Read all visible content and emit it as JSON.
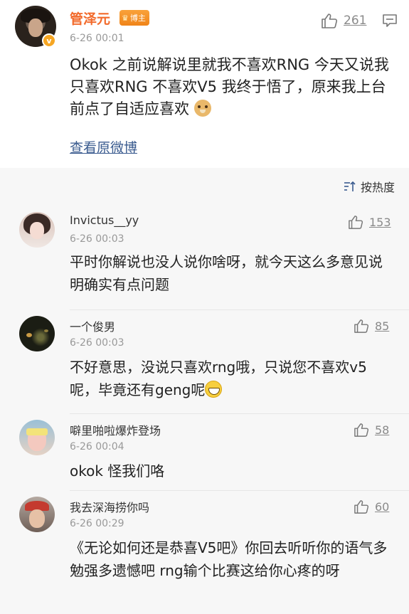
{
  "post": {
    "author": "管泽元",
    "badge_label": "博主",
    "verified_mark": "v",
    "time": "6-26 00:01",
    "like_count": "261",
    "text": "Okok 之前说解说里就我不喜欢RNG 今天又说我只喜欢RNG 不喜欢V5 我终于悟了，原来我上台前点了自适应喜欢",
    "view_original": "查看原微博",
    "icons": [
      "thumb-up-icon",
      "comment-icon",
      "doge-emoji"
    ]
  },
  "sort": {
    "label": "按热度",
    "icon": "sort-icon"
  },
  "comments": [
    {
      "name": "Invictus__yy",
      "time": "6-26 00:03",
      "likes": "153",
      "text": "平时你解说也没人说你啥呀，就今天这么多意见说明确实有点问题"
    },
    {
      "name": "一个俊男",
      "time": "6-26 00:03",
      "likes": "85",
      "text": "不好意思，没说只喜欢rng哦，只说您不喜欢v5呢，毕竟还有geng呢"
    },
    {
      "name": "噼里啪啦爆炸登场",
      "time": "6-26 00:04",
      "likes": "58",
      "text": "okok 怪我们咯"
    },
    {
      "name": "我去深海捞你吗",
      "time": "6-26 00:29",
      "likes": "60",
      "text": "《无论如何还是恭喜V5吧》你回去听听你的语气多勉强多遗憾吧 rng输个比赛这给你心疼的呀"
    }
  ],
  "colors": {
    "author_orange": "#f26a2b",
    "link_blue": "#3a5b8f",
    "meta_gray": "#999999",
    "comments_bg": "#f7f7f7"
  }
}
